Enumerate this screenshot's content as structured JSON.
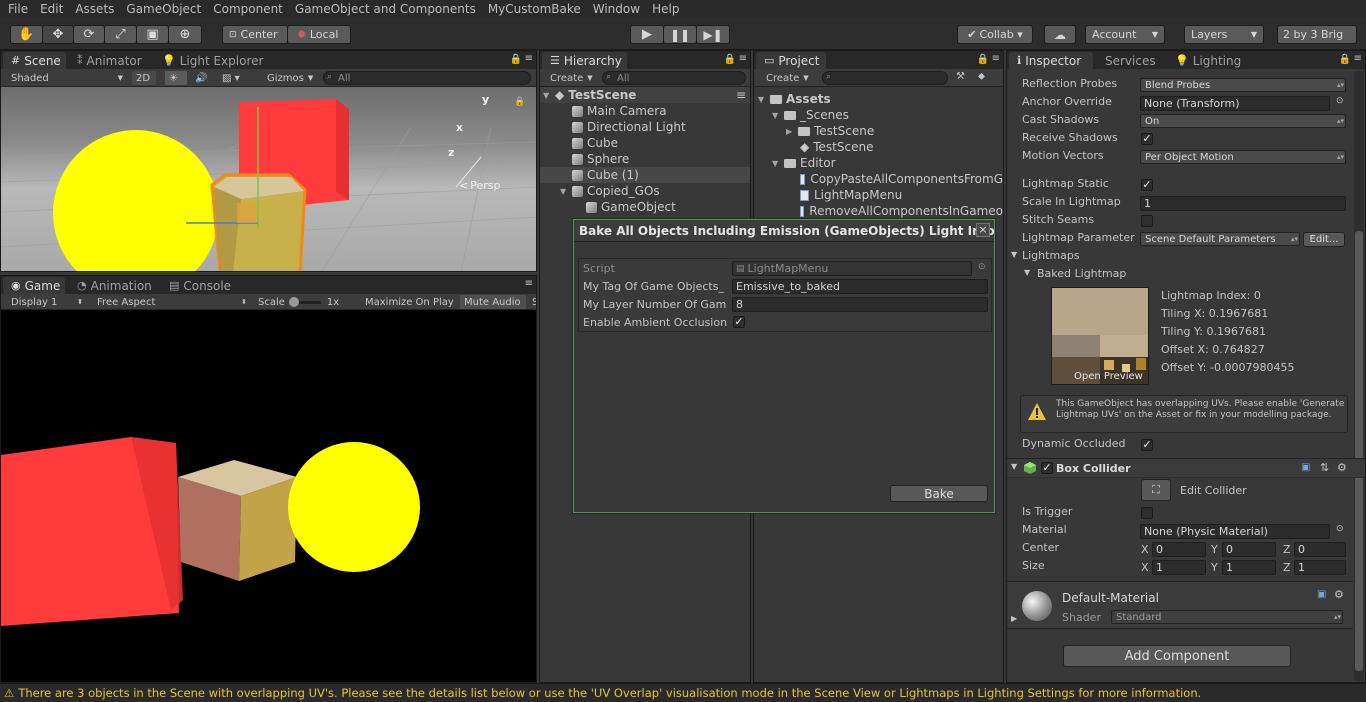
{
  "menu": [
    "File",
    "Edit",
    "Assets",
    "GameObject",
    "Component",
    "GameObject and Components",
    "MyCustomBake",
    "Window",
    "Help"
  ],
  "toolbar": {
    "center_label": "Center",
    "local_label": "Local",
    "collab_label": "Collab ▾",
    "account_label": "Account",
    "layers_label": "Layers",
    "layout_label": "2 by 3 Brig"
  },
  "scene_panel": {
    "tabs": [
      "Scene",
      "Animator",
      "Light Explorer"
    ],
    "shading": "Shaded",
    "mode_2d": "2D",
    "gizmos": "Gizmos",
    "search_placeholder": "All",
    "persp": "Persp",
    "axis_x": "x",
    "axis_y": "y",
    "axis_z": "z"
  },
  "game_panel": {
    "tabs": [
      "Game",
      "Animation",
      "Console"
    ],
    "display": "Display 1",
    "aspect": "Free Aspect",
    "scale_label": "Scale",
    "scale_value": "1x",
    "maximize": "Maximize On Play",
    "mute": "Mute Audio",
    "stats": "S"
  },
  "hierarchy": {
    "tab": "Hierarchy",
    "create": "Create",
    "search_placeholder": "All",
    "scene": "TestScene",
    "items": [
      "Main Camera",
      "Directional Light",
      "Cube",
      "Sphere",
      "Cube (1)",
      "Copied_GOs",
      "GameObject"
    ]
  },
  "project": {
    "tab": "Project",
    "create": "Create",
    "assets": "Assets",
    "scenes_folder": "_Scenes",
    "testscene_folder": "TestScene",
    "testscene_asset": "TestScene",
    "editor_folder": "Editor",
    "scripts": [
      "CopyPasteAllComponentsFromG",
      "LightMapMenu",
      "RemoveAllComponentsInGameo"
    ]
  },
  "dialog": {
    "title": "Bake All Objects Including Emission (GameObjects) Light Into L...",
    "close": "×",
    "script_label": "Script",
    "script_value": "LightMapMenu",
    "tag_label": "My Tag Of Game Objects_",
    "tag_value": "Emissive_to_baked",
    "layer_label": "My Layer Number Of Gam",
    "layer_value": "8",
    "ambient_label": "Enable Ambient Occlusion",
    "ambient_checked": "✓",
    "bake_button": "Bake"
  },
  "inspector": {
    "tabs": [
      "Inspector",
      "Services",
      "Lighting"
    ],
    "reflection_probes_label": "Reflection Probes",
    "reflection_probes_value": "Blend Probes",
    "anchor_override_label": "Anchor Override",
    "anchor_override_value": "None (Transform)",
    "cast_shadows_label": "Cast Shadows",
    "cast_shadows_value": "On",
    "receive_shadows_label": "Receive Shadows",
    "motion_vectors_label": "Motion Vectors",
    "motion_vectors_value": "Per Object Motion",
    "lightmap_static_label": "Lightmap Static",
    "scale_in_lightmap_label": "Scale In Lightmap",
    "scale_in_lightmap_value": "1",
    "stitch_seams_label": "Stitch Seams",
    "lightmap_parameter_label": "Lightmap Parameter",
    "lightmap_parameter_value": "Scene Default Parameters",
    "edit_button": "Edit...",
    "lightmaps_label": "Lightmaps",
    "baked_lightmap_label": "Baked Lightmap",
    "lightmap_index": "Lightmap Index: 0",
    "tiling_x": "Tiling X: 0.1967681",
    "tiling_y": "Tiling Y: 0.1967681",
    "offset_x": "Offset X: 0.764827",
    "offset_y": "Offset Y: -0.0007980455",
    "open_preview": "Open Preview",
    "warning": "This GameObject has overlapping UVs. Please enable 'Generate Lightmap UVs' on the Asset or fix in your modelling package.",
    "dynamic_occluded_label": "Dynamic Occluded",
    "box_collider_label": "Box Collider",
    "edit_collider_label": "Edit Collider",
    "is_trigger_label": "Is Trigger",
    "material_label": "Material",
    "material_value": "None (Physic Material)",
    "center_label": "Center",
    "center": {
      "x": "0",
      "y": "0",
      "z": "0"
    },
    "size_label": "Size",
    "size": {
      "x": "1",
      "y": "1",
      "z": "1"
    },
    "axis_x": "X",
    "axis_y": "Y",
    "axis_z": "Z",
    "default_material": "Default-Material",
    "shader_label": "Shader",
    "shader_value": "Standard",
    "add_component": "Add Component"
  },
  "status": "There are 3 objects in the Scene with overlapping UV's. Please see the details list below or use the 'UV Overlap' visualisation mode in the Scene View or Lightmaps in Lighting Settings for more information.",
  "colors": {
    "sphere": "#ffff00",
    "red_cube": "#ff3b3b",
    "selection_outline": "#f08a1d",
    "warning": "#e8c33a"
  }
}
